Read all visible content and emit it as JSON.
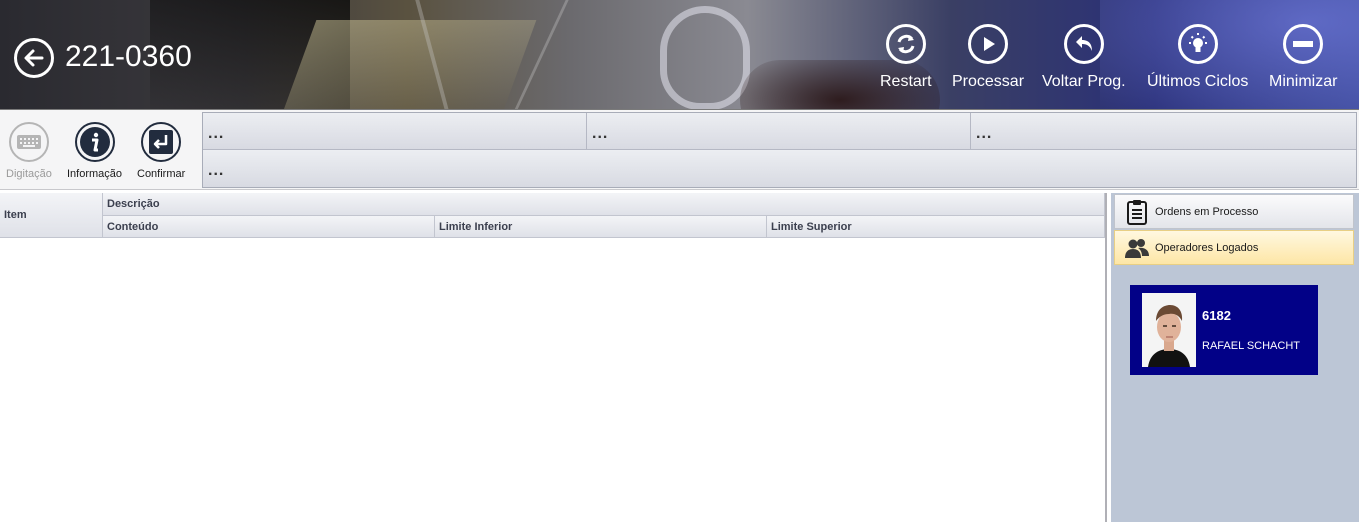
{
  "header": {
    "title": "221-0360",
    "back_icon": "back-arrow-icon",
    "actions": [
      {
        "label": "Restart",
        "icon": "refresh-icon"
      },
      {
        "label": "Processar",
        "icon": "play-icon"
      },
      {
        "label": "Voltar Prog.",
        "icon": "undo-arrow-icon"
      },
      {
        "label": "Últimos Ciclos",
        "icon": "lightbulb-icon"
      },
      {
        "label": "Minimizar",
        "icon": "minus-icon"
      }
    ]
  },
  "toolbar": {
    "buttons": [
      {
        "label": "Digitação",
        "icon": "keyboard-icon",
        "enabled": false
      },
      {
        "label": "Informação",
        "icon": "info-icon",
        "enabled": true
      },
      {
        "label": "Confirmar",
        "icon": "enter-icon",
        "enabled": true
      }
    ],
    "info_cells": [
      "...",
      "...",
      "...",
      "..."
    ]
  },
  "table": {
    "headers": {
      "item": "Item",
      "descricao": "Descrição",
      "conteudo": "Conteúdo",
      "limite_inferior": "Limite Inferior",
      "limite_superior": "Limite Superior"
    },
    "rows": []
  },
  "side_panel": {
    "tabs": [
      {
        "label": "Ordens em Processo",
        "icon": "clipboard-icon"
      },
      {
        "label": "Operadores Logados",
        "icon": "users-icon",
        "active": true
      }
    ],
    "operators": [
      {
        "id": "6182",
        "name": "RAFAEL SCHACHT"
      }
    ]
  },
  "colors": {
    "operator_card": "#020187",
    "active_tab": "#fde6a6",
    "side_panel_bg": "#bcc6d6"
  }
}
